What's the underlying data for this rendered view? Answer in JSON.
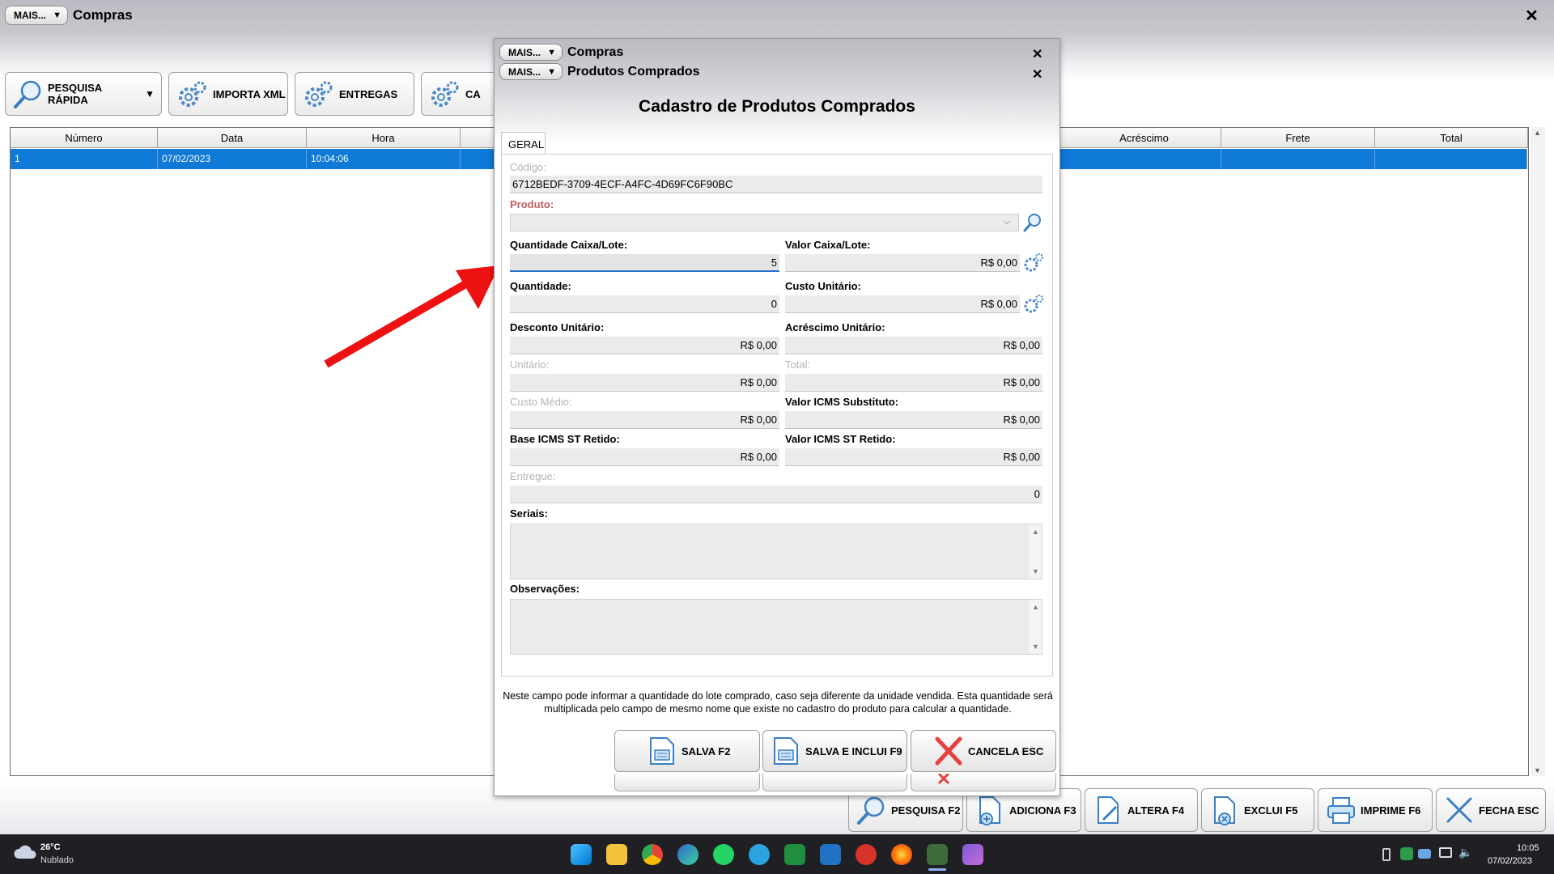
{
  "main": {
    "mais_label": "MAIS...",
    "title": "Compras",
    "toolbar": {
      "pesquisa_rapida": "PESQUISA RÁPIDA",
      "importa_xml": "IMPORTA XML",
      "entregas": "ENTREGAS",
      "partial": "CA"
    },
    "grid": {
      "columns": [
        "Número",
        "Data",
        "Hora",
        "Acréscimo",
        "Frete",
        "Total"
      ],
      "rows": [
        {
          "numero": "1",
          "data": "07/02/2023",
          "hora": "10:04:06",
          "acrescimo": "",
          "frete": "",
          "total": ""
        }
      ]
    },
    "bottom_buttons": {
      "pesquisa": "PESQUISA F2",
      "adiciona": "ADICIONA F3",
      "altera": "ALTERA F4",
      "exclui": "EXCLUI F5",
      "imprime": "IMPRIME F6",
      "fecha": "FECHA ESC"
    }
  },
  "dialog": {
    "mais_label": "MAIS...",
    "parent_title": "Compras",
    "title_bar": "Produtos Comprados",
    "heading": "Cadastro de Produtos Comprados",
    "tab": "GERAL",
    "fields": {
      "codigo": {
        "label": "Código:",
        "value": "6712BEDF-3709-4ECF-A4FC-4D69FC6F90BC"
      },
      "produto": {
        "label": "Produto:",
        "value": ""
      },
      "qtd_caixa": {
        "label": "Quantidade Caixa/Lote:",
        "value": "5"
      },
      "valor_caixa": {
        "label": "Valor Caixa/Lote:",
        "value": "R$ 0,00"
      },
      "quantidade": {
        "label": "Quantidade:",
        "value": "0"
      },
      "custo_unitario": {
        "label": "Custo Unitário:",
        "value": "R$ 0,00"
      },
      "desconto_unitario": {
        "label": "Desconto Unitário:",
        "value": "R$ 0,00"
      },
      "acrescimo_unitario": {
        "label": "Acréscimo Unitário:",
        "value": "R$ 0,00"
      },
      "unitario": {
        "label": "Unitário:",
        "value": "R$ 0,00"
      },
      "total": {
        "label": "Total:",
        "value": "R$ 0,00"
      },
      "custo_medio": {
        "label": "Custo Médio:",
        "value": "R$ 0,00"
      },
      "valor_icms_subst": {
        "label": "Valor ICMS Substituto:",
        "value": "R$ 0,00"
      },
      "base_icms_st": {
        "label": "Base ICMS ST Retido:",
        "value": "R$ 0,00"
      },
      "valor_icms_st": {
        "label": "Valor ICMS ST Retido:",
        "value": "R$ 0,00"
      },
      "entregue": {
        "label": "Entregue:",
        "value": "0"
      },
      "seriais": {
        "label": "Seriais:"
      },
      "observacoes": {
        "label": "Observações:"
      }
    },
    "hint": "Neste campo pode informar a quantidade do lote comprado, caso seja diferente da unidade vendida. Esta quantidade será multiplicada pelo campo de mesmo nome que existe no cadastro do produto para calcular a quantidade.",
    "buttons": {
      "salva": "SALVA F2",
      "salva_inclui": "SALVA E INCLUI F9",
      "cancela": "CANCELA ESC"
    }
  },
  "taskbar": {
    "weather_temp": "26°C",
    "weather_desc": "Nublado",
    "time": "10:05",
    "date": "07/02/2023"
  },
  "colors": {
    "selection": "#0e79d6",
    "annotation_arrow": "#ee1111",
    "required_label": "#c06060"
  }
}
